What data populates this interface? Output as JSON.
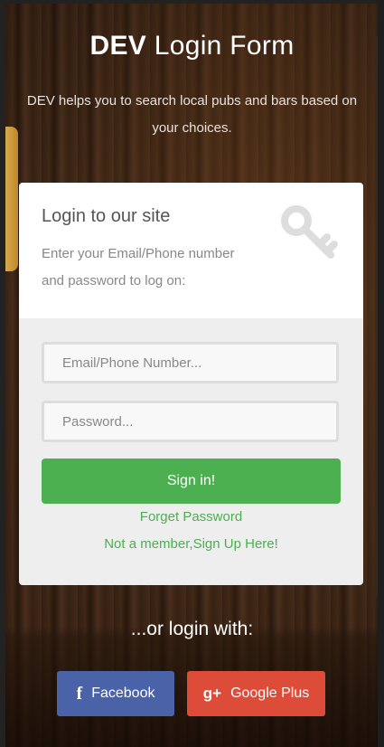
{
  "header": {
    "title_strong": "DEV",
    "title_light": "Login Form",
    "description": "DEV helps you to search local pubs and bars based on your choices."
  },
  "card": {
    "heading": "Login to our site",
    "instructions": "Enter your Email/Phone number and password to log on:",
    "icon": "key-icon",
    "email_placeholder": "Email/Phone Number...",
    "password_placeholder": "Password...",
    "signin_label": "Sign in!",
    "forget_label": "Forget Password",
    "signup_label": "Not a member,Sign Up Here!"
  },
  "social": {
    "or_text": "...or login with:",
    "facebook_icon": "f",
    "facebook_label": "Facebook",
    "google_icon": "g+",
    "google_label": "Google Plus"
  },
  "colors": {
    "accent_green": "#4caf50",
    "facebook_blue": "#4a62a8",
    "google_red": "#dd4b39"
  }
}
